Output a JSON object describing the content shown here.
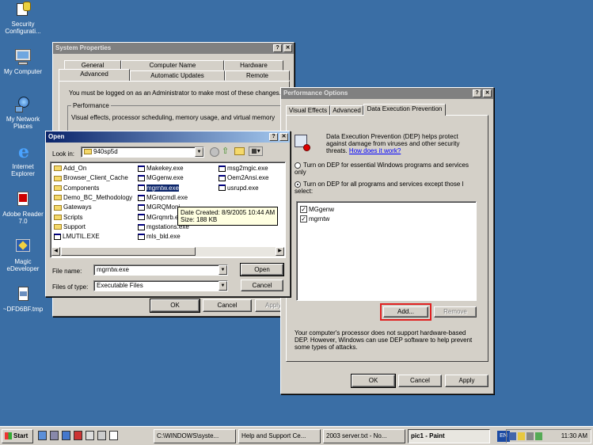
{
  "desktop": {
    "icons": [
      {
        "label": "Security Configurati...",
        "icon": "security-config-icon"
      },
      {
        "label": "My Computer",
        "icon": "computer-icon"
      },
      {
        "label": "My Network Places",
        "icon": "network-icon"
      },
      {
        "label": "Internet Explorer",
        "icon": "ie-icon"
      },
      {
        "label": "Adobe Reader 7.0",
        "icon": "adobe-icon"
      },
      {
        "label": "Magic eDeveloper",
        "icon": "magic-icon"
      },
      {
        "label": "~DFD6BF.tmp",
        "icon": "tmp-file-icon"
      }
    ]
  },
  "sysprops": {
    "title": "System Properties",
    "tabs_row1": [
      "General",
      "Computer Name",
      "Hardware"
    ],
    "tabs_row2": [
      "Advanced",
      "Automatic Updates",
      "Remote"
    ],
    "admin_note": "You must be logged on as an Administrator to make most of these changes.",
    "perf_group": "Performance",
    "perf_desc": "Visual effects, processor scheduling, memory usage, and virtual memory",
    "ok": "OK",
    "cancel": "Cancel",
    "apply": "Apply"
  },
  "open": {
    "title": "Open",
    "look_in_label": "Look in:",
    "look_in_value": "940sp5d",
    "col1": [
      "Add_On",
      "Browser_Client_Cache",
      "Components",
      "Demo_BC_Methodology",
      "Gateways",
      "Scripts",
      "Support",
      "LMUTIL.EXE"
    ],
    "col2": [
      "Makekey.exe",
      "MGgenw.exe",
      "mgrntw.exe",
      "MGrqcmdl.exe",
      "MGRQMoni...",
      "MGrqmrb.e...",
      "mgstations.exe",
      "mls_bld.exe"
    ],
    "col3": [
      "msg2mgic.exe",
      "Oem2Ansi.exe",
      "usrupd.exe"
    ],
    "tooltip_line1": "Date Created: 8/9/2005 10:44 AM",
    "tooltip_line2": "Size: 188 KB",
    "filename_label": "File name:",
    "filename_value": "mgrntw.exe",
    "filetype_label": "Files of type:",
    "filetype_value": "Executable Files",
    "open_btn": "Open",
    "cancel_btn": "Cancel"
  },
  "perf": {
    "title": "Performance Options",
    "tabs": [
      "Visual Effects",
      "Advanced",
      "Data Execution Prevention"
    ],
    "dep_desc": "Data Execution Prevention (DEP) helps protect against damage from viruses and other security threats.",
    "dep_link": "How does it work?",
    "radio1": "Turn on DEP for essential Windows programs and services only",
    "radio2": "Turn on DEP for all programs and services except those I select:",
    "list": [
      "MGgenw",
      "mgrntw"
    ],
    "add": "Add...",
    "remove": "Remove",
    "footer": "Your computer's processor does not support hardware-based DEP. However, Windows can use DEP software to help prevent some types of attacks.",
    "ok": "OK",
    "cancel": "Cancel",
    "apply": "Apply"
  },
  "taskbar": {
    "start": "Start",
    "tasks": [
      "C:\\WINDOWS\\syste...",
      "Help and Support Ce...",
      "2003 server.txt - No...",
      "pic1 - Paint"
    ],
    "lang": "EN",
    "clock": "11:30 AM"
  }
}
